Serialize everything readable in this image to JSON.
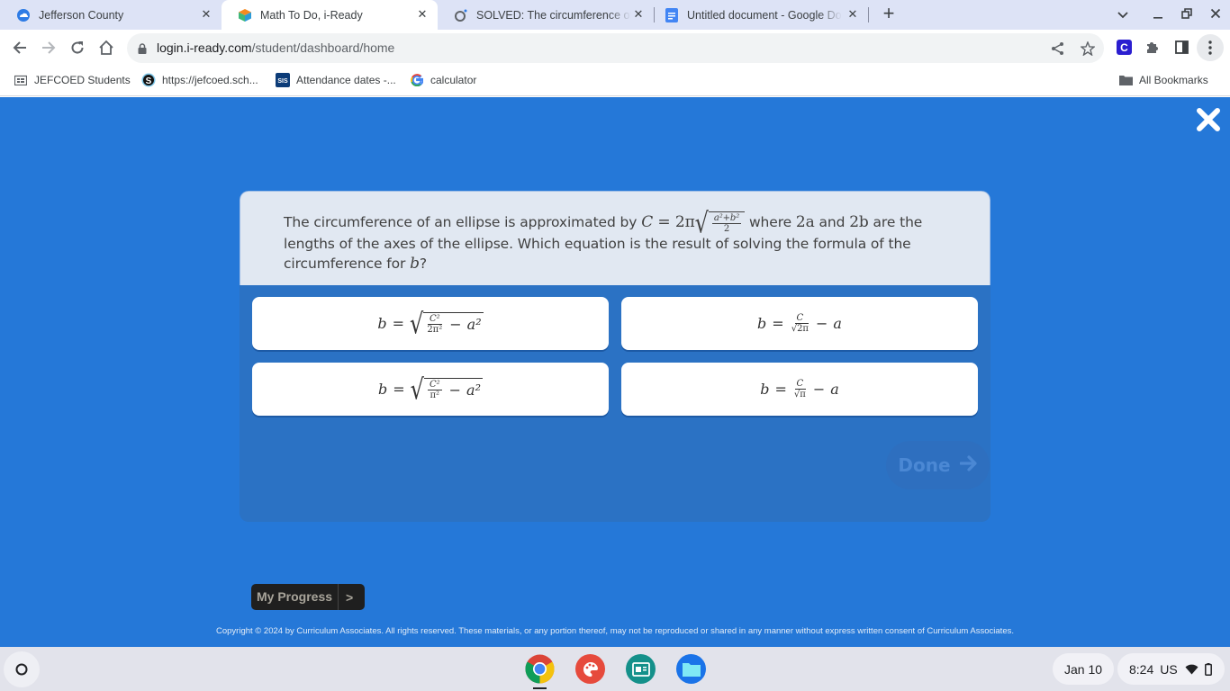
{
  "browser": {
    "tabs": [
      {
        "title": "Jefferson County",
        "icon": "cloud-icon",
        "active": false
      },
      {
        "title": "Math To Do, i-Ready",
        "icon": "iready-cube-icon",
        "active": true
      },
      {
        "title": "SOLVED: The circumference of a",
        "icon": "numerade-icon",
        "active": false
      },
      {
        "title": "Untitled document - Google Doc",
        "icon": "google-docs-icon",
        "active": false
      }
    ],
    "close_glyph": "✕",
    "new_tab_glyph": "+",
    "url_host": "login.i-ready.com",
    "url_path": "/student/dashboard/home",
    "bookmarks": [
      {
        "label": "JEFCOED Students",
        "icon": "folder-grid-icon"
      },
      {
        "label": "https://jefcoed.sch...",
        "icon": "schoology-icon"
      },
      {
        "label": "Attendance dates -...",
        "icon": "sis-icon"
      },
      {
        "label": "calculator",
        "icon": "google-icon"
      }
    ],
    "all_bookmarks": "All Bookmarks",
    "sis_badge": "SIS",
    "ext_letter": "C"
  },
  "lesson": {
    "question": {
      "part1": "The circumference of an ellipse is approximated by ",
      "formula_lhs": "C",
      "formula_eq": " = 2π",
      "formula_num": "a²+b²",
      "formula_den": "2",
      "part2": " where ",
      "var_2a": "2a",
      "part3": " and ",
      "var_2b": "2b",
      "part4": " are the lengths of the axes of the ellipse. Which equation is the result of solving the formula of the circumference for ",
      "var_b": "b",
      "part5": "?"
    },
    "choices": [
      {
        "id": "A",
        "lhs": "b",
        "num": "C²",
        "den": "2π²",
        "minus": "a²",
        "form": "sqrt-of-fraction-minus"
      },
      {
        "id": "B",
        "lhs": "b",
        "num": "C",
        "den_sqrt": "2π",
        "minus": "a",
        "form": "fraction-over-sqrt-minus"
      },
      {
        "id": "C",
        "lhs": "b",
        "num": "C²",
        "den": "π²",
        "minus": "a²",
        "form": "sqrt-of-fraction-minus"
      },
      {
        "id": "D",
        "lhs": "b",
        "num": "C",
        "den_sqrt": "π",
        "minus": "a",
        "form": "fraction-over-sqrt-minus"
      }
    ],
    "eq_sign": "=",
    "minus_sign": "−",
    "radical": "√",
    "done_label": "Done",
    "done_arrow": "➜",
    "done_enabled": false,
    "progress_label": "My Progress",
    "progress_chevron": ">",
    "copyright": "Copyright © 2024 by Curriculum Associates. All rights reserved. These materials, or any portion thereof, may not be reproduced or shared in any manner without express written consent of Curriculum Associates."
  },
  "shelf": {
    "apps": [
      "chrome-icon",
      "canvas-paint-icon",
      "google-classroom-icon",
      "files-icon"
    ],
    "date": "Jan 10",
    "time": "8:24",
    "locale": "US"
  },
  "colors": {
    "page_bg": "#2578d8",
    "card_bg": "#2b72c4",
    "stem_bg": "#e1e8f2",
    "tab_strip": "#dde3f6"
  }
}
